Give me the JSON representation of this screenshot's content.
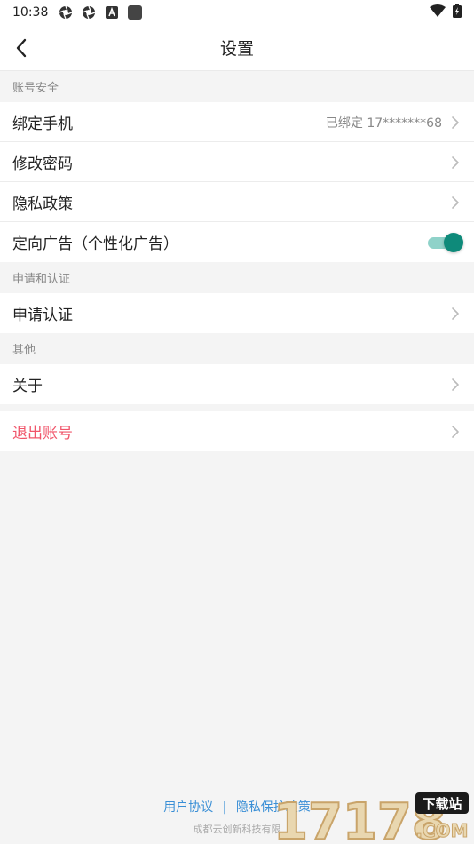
{
  "status_bar": {
    "time": "10:38",
    "left_icons": [
      "aperture-icon",
      "aperture-icon",
      "android-badge-icon",
      "square-icon"
    ],
    "right_icons": [
      "wifi-icon",
      "battery-charging-icon"
    ]
  },
  "header": {
    "title": "设置",
    "back_icon": "chevron-left-icon"
  },
  "sections": {
    "account": {
      "header": "账号安全",
      "bind_phone": {
        "label": "绑定手机",
        "value": "已绑定 17*******68"
      },
      "change_password": {
        "label": "修改密码"
      },
      "privacy_policy": {
        "label": "隐私政策"
      },
      "targeted_ads": {
        "label": "定向广告（个性化广告）",
        "enabled": true
      }
    },
    "application": {
      "header": "申请和认证",
      "apply_verify": {
        "label": "申请认证"
      }
    },
    "other": {
      "header": "其他",
      "about": {
        "label": "关于"
      }
    },
    "logout": {
      "label": "退出账号"
    }
  },
  "footer": {
    "user_agreement": "用户协议",
    "separator": "|",
    "privacy_protection": "隐私保护政策",
    "company": "成都云创新科技有限"
  },
  "watermark": {
    "text": "17178",
    "badge": "下载站",
    "domain": ".COM"
  },
  "colors": {
    "background": "#f4f4f4",
    "accent_toggle": "#0e8a7a",
    "logout_red": "#f0556a",
    "link_blue": "#3a8fd6"
  }
}
